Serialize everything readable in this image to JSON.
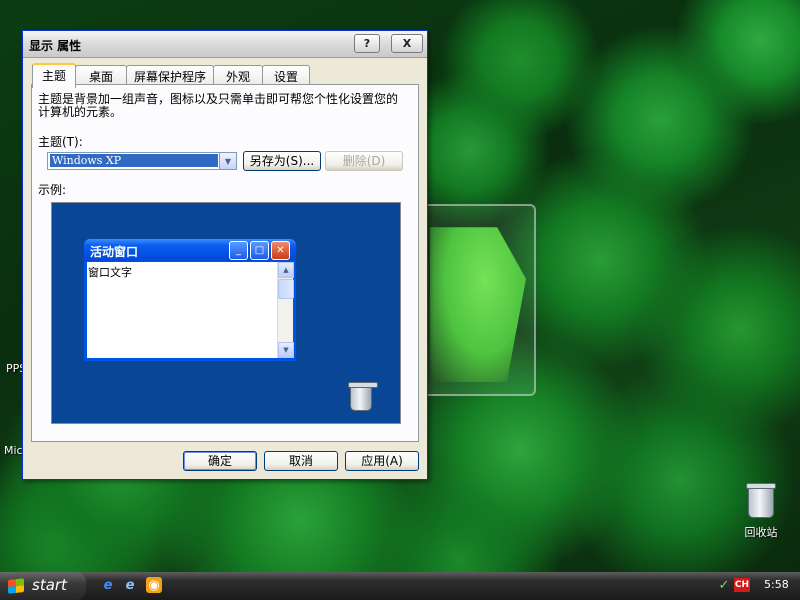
{
  "dialog": {
    "title": "显示 属性",
    "help_symbol": "?",
    "close_symbol": "X",
    "tabs": [
      {
        "label": "主题",
        "active": true
      },
      {
        "label": "桌面",
        "active": false
      },
      {
        "label": "屏幕保护程序",
        "active": false
      },
      {
        "label": "外观",
        "active": false
      },
      {
        "label": "设置",
        "active": false
      }
    ],
    "description": "主题是背景加一组声音，图标以及只需单击即可帮您个性化设置您的计算机的元素。",
    "theme_label": "主题(T):",
    "theme_value": "Windows XP",
    "save_as_label": "另存为(S)...",
    "delete_label": "删除(D)",
    "preview_label": "示例:",
    "preview_window_title": "活动窗口",
    "preview_window_text": "窗口文字",
    "ok_label": "确定",
    "cancel_label": "取消",
    "apply_label": "应用(A)"
  },
  "desktop": {
    "labels": {
      "pps": "PPS",
      "micr": "Micr",
      "recycle_bin": "回收站"
    }
  },
  "taskbar": {
    "start_label": "start",
    "lang": "CH",
    "clock": "5:58"
  },
  "colors": {
    "preview_desktop": "#0a4696",
    "xp_blue_title": "#0054e3",
    "selection": "#316ac5",
    "dialog_bg": "#ece9d8"
  }
}
